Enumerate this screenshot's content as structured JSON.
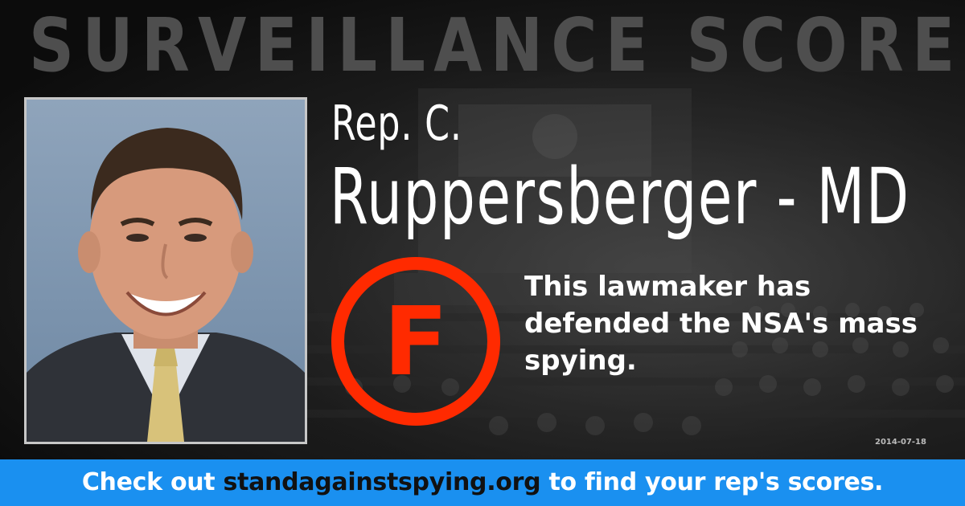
{
  "header": {
    "title": "SURVEILLANCE SCORECARD"
  },
  "representative": {
    "photo_icon": "portrait-photo",
    "title_line": "Rep. C.",
    "name_line": "Ruppersberger - MD"
  },
  "grade": {
    "letter": "F",
    "color": "#ff2a00"
  },
  "message": {
    "text": "This lawmaker has defended the NSA's mass spying."
  },
  "date": "2014-07-18",
  "banner": {
    "prefix": "Check out",
    "link": "standagainstspying.org",
    "suffix": "to find your rep's scores.",
    "color": "#1a90f0"
  }
}
